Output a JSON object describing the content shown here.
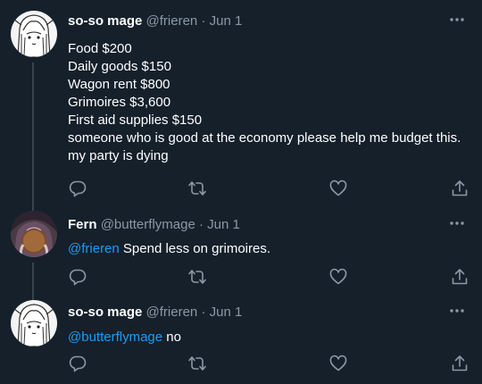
{
  "tweets": [
    {
      "name": "so-so mage",
      "handle": "@frieren",
      "dot": "·",
      "date": "Jun 1",
      "lines": [
        "Food $200",
        "Daily goods $150",
        "Wagon rent $800",
        "Grimoires $3,600",
        "First aid supplies $150",
        "someone who is good at the economy please help me budget this. my party is dying"
      ]
    },
    {
      "name": "Fern",
      "handle": "@butterflymage",
      "dot": "·",
      "date": "Jun 1",
      "mention": "@frieren",
      "text": " Spend less on grimoires."
    },
    {
      "name": "so-so mage",
      "handle": "@frieren",
      "dot": "·",
      "date": "Jun 1",
      "mention": "@butterflymage",
      "text": " no"
    }
  ],
  "icons": {
    "more": "more-horizontal-icon",
    "reply": "reply-icon",
    "retweet": "retweet-icon",
    "like": "heart-icon",
    "share": "share-icon"
  },
  "colors": {
    "background": "#15202b",
    "secondary_text": "#8b98a5",
    "mention": "#1d9bf0",
    "thread_line": "#38444d"
  }
}
